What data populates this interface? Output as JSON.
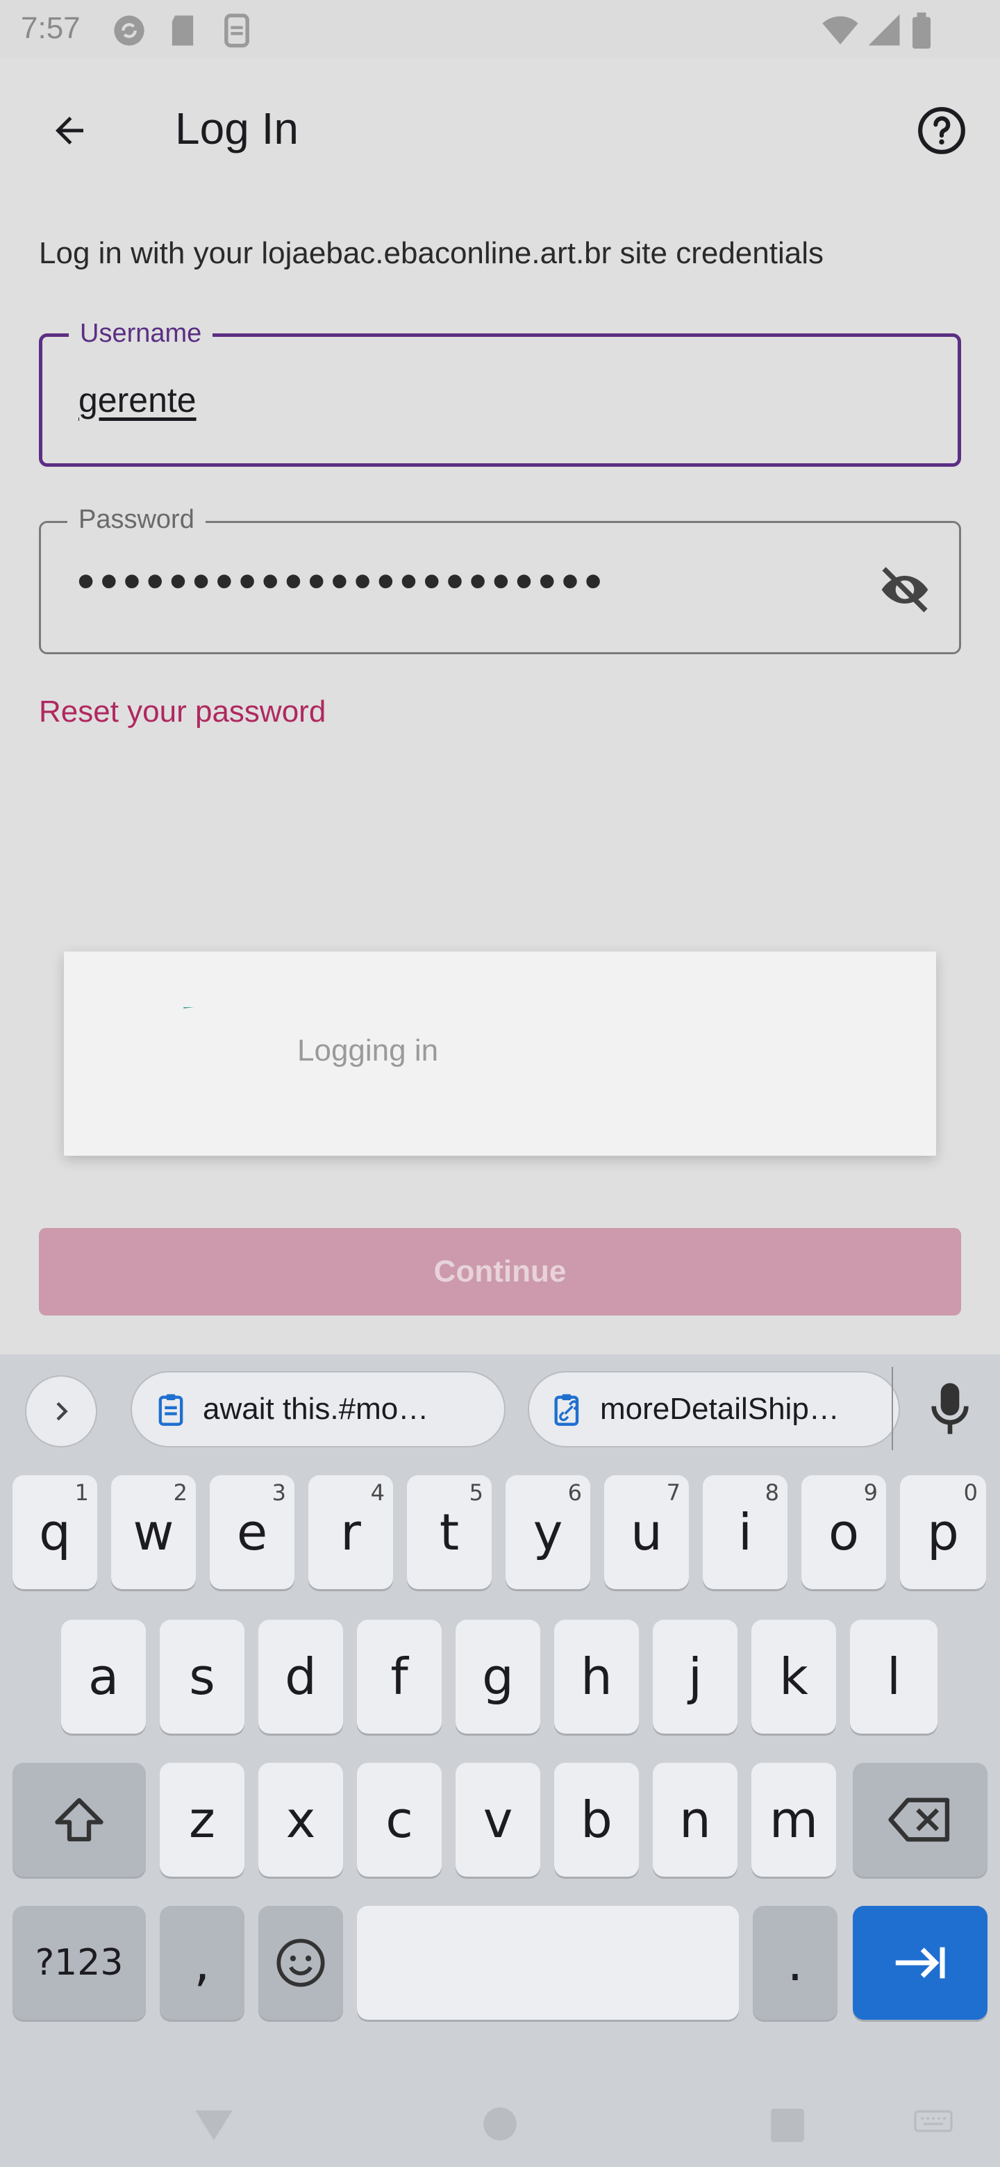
{
  "status_bar": {
    "time": "7:57",
    "left_icons": [
      "sync-icon",
      "sd-card-icon",
      "storage-icon"
    ],
    "right_icons": [
      "wifi-icon",
      "signal-icon",
      "battery-icon"
    ]
  },
  "app_bar": {
    "back_icon": "arrow-back-icon",
    "title": "Log In",
    "help_icon": "help-circle-icon"
  },
  "login": {
    "instruction": "Log in with your lojaebac.ebaconline.art.br site credentials",
    "username": {
      "label": "Username",
      "value": "gerente"
    },
    "password": {
      "label": "Password",
      "masked_value": "•••••••••••••••••••••••",
      "visibility_icon": "visibility-off-icon"
    },
    "reset_link": "Reset your password",
    "continue_label": "Continue"
  },
  "dialog": {
    "message": "Logging in",
    "spinner_color": "#4fa8a0"
  },
  "keyboard": {
    "clipboard_chips": [
      {
        "text": "await this.#mo…",
        "icon": "clipboard-icon"
      },
      {
        "text": "moreDetailShip…",
        "icon": "clipboard-link-icon"
      }
    ],
    "rows": [
      [
        {
          "k": "q",
          "h": "1"
        },
        {
          "k": "w",
          "h": "2"
        },
        {
          "k": "e",
          "h": "3"
        },
        {
          "k": "r",
          "h": "4"
        },
        {
          "k": "t",
          "h": "5"
        },
        {
          "k": "y",
          "h": "6"
        },
        {
          "k": "u",
          "h": "7"
        },
        {
          "k": "i",
          "h": "8"
        },
        {
          "k": "o",
          "h": "9"
        },
        {
          "k": "p",
          "h": "0"
        }
      ],
      [
        {
          "k": "a"
        },
        {
          "k": "s"
        },
        {
          "k": "d"
        },
        {
          "k": "f"
        },
        {
          "k": "g"
        },
        {
          "k": "h"
        },
        {
          "k": "j"
        },
        {
          "k": "k"
        },
        {
          "k": "l"
        }
      ],
      [
        {
          "k": "z"
        },
        {
          "k": "x"
        },
        {
          "k": "c"
        },
        {
          "k": "v"
        },
        {
          "k": "b"
        },
        {
          "k": "n"
        },
        {
          "k": "m"
        }
      ]
    ],
    "symbols_label": "?123",
    "comma": ",",
    "period": ".",
    "accent_color": "#1f6fd0"
  },
  "colors": {
    "primary": "#5b2f83",
    "link": "#b0285f",
    "continue_disabled": "#cc9aac"
  }
}
